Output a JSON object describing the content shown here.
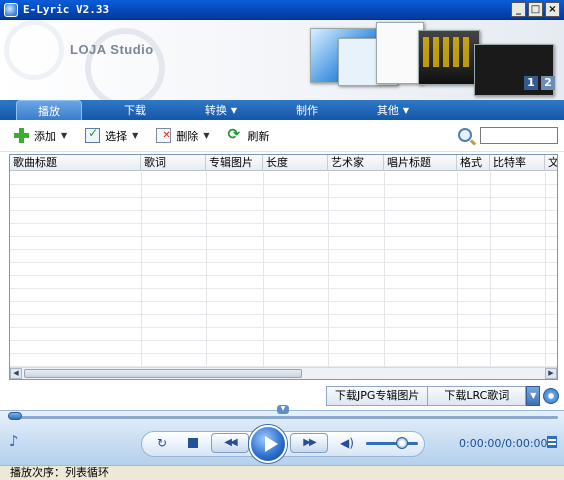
{
  "window": {
    "title": "E-Lyric V2.33",
    "controls": [
      "_",
      "□",
      "×"
    ]
  },
  "banner": {
    "brand": "LOJA Studio",
    "slides": [
      "1",
      "2"
    ]
  },
  "nav": {
    "tabs": [
      {
        "label": "播放",
        "caret": ""
      },
      {
        "label": "下载",
        "caret": ""
      },
      {
        "label": "转换",
        "caret": "▼"
      },
      {
        "label": "制作",
        "caret": ""
      },
      {
        "label": "其他",
        "caret": "▼"
      }
    ]
  },
  "toolbar": {
    "add": "添加",
    "select": "选择",
    "delete": "删除",
    "refresh": "刷新",
    "dropdown": "▼",
    "search": {
      "value": "",
      "placeholder": ""
    }
  },
  "table": {
    "columns": [
      "歌曲标题",
      "歌词",
      "专辑图片",
      "长度",
      "艺术家",
      "唱片标题",
      "格式",
      "比特率",
      "文"
    ],
    "rows": []
  },
  "download": {
    "jpg_button": "下载JPG专辑图片",
    "lrc_button": "下载LRC歌词",
    "arrow": "▼"
  },
  "player": {
    "note_icon": "♪",
    "repeat_icon": "↻",
    "prev": "◀◀",
    "next": "▶▶",
    "volume_icon": "◀)",
    "time": "0:00:00/0:00:00",
    "volume_level": 0.7
  },
  "status": {
    "text": "播放次序：列表循环"
  },
  "colors": {
    "titlebar": "#0446b6",
    "nav": "#1656a8",
    "player": "#c6dcf2",
    "accent": "#2f6fba"
  }
}
